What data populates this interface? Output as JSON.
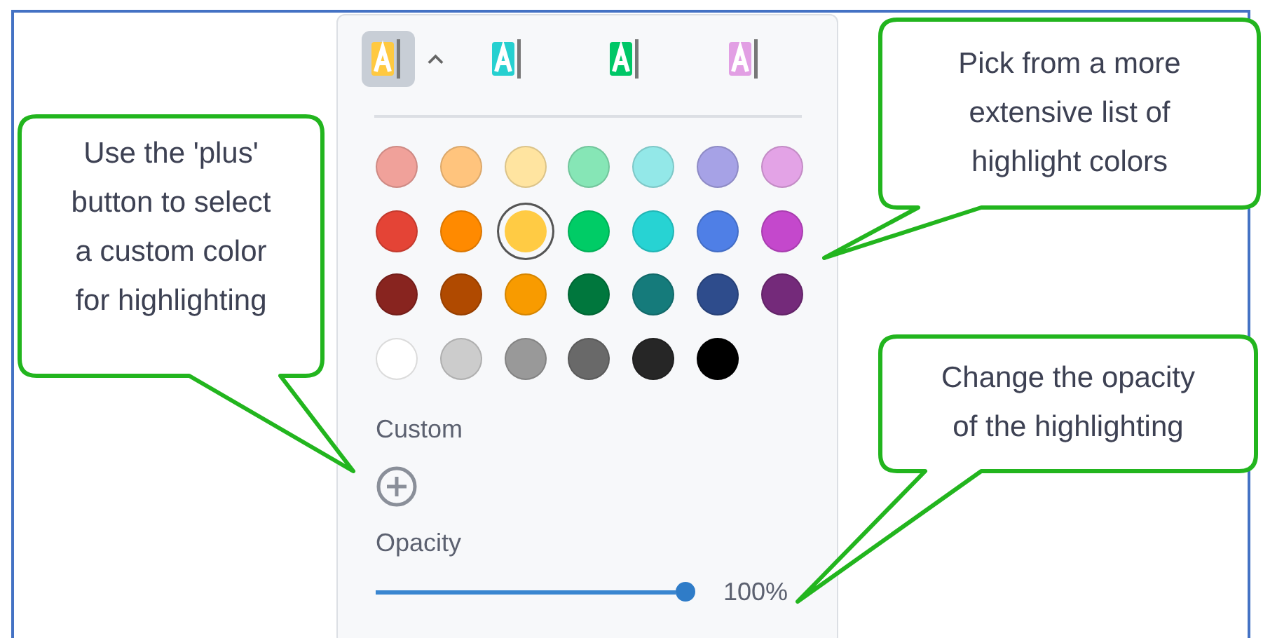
{
  "toolbar": {
    "tools": [
      {
        "color": "#ffc940",
        "selected": true
      },
      {
        "color": "#26d0d0",
        "selected": false
      },
      {
        "color": "#00c767",
        "selected": false
      },
      {
        "color": "#e29fe4",
        "selected": false
      }
    ]
  },
  "swatches": [
    {
      "color": "#f0a19a",
      "selected": false
    },
    {
      "color": "#ffc47d",
      "selected": false
    },
    {
      "color": "#ffe4a0",
      "selected": false
    },
    {
      "color": "#86e6b6",
      "selected": false
    },
    {
      "color": "#93e8e8",
      "selected": false
    },
    {
      "color": "#a6a2e6",
      "selected": false
    },
    {
      "color": "#e3a3e6",
      "selected": false
    },
    {
      "color": "#e44436",
      "selected": false
    },
    {
      "color": "#ff8a00",
      "selected": false
    },
    {
      "color": "#ffcb44",
      "selected": true
    },
    {
      "color": "#00cc66",
      "selected": false
    },
    {
      "color": "#27d3d3",
      "selected": false
    },
    {
      "color": "#4f7fe6",
      "selected": false
    },
    {
      "color": "#c448cc",
      "selected": false
    },
    {
      "color": "#88241f",
      "selected": false
    },
    {
      "color": "#b04a00",
      "selected": false
    },
    {
      "color": "#f89b00",
      "selected": false
    },
    {
      "color": "#00773d",
      "selected": false
    },
    {
      "color": "#157b7b",
      "selected": false
    },
    {
      "color": "#2e4c8c",
      "selected": false
    },
    {
      "color": "#742a7a",
      "selected": false
    },
    {
      "color": "#ffffff",
      "selected": false
    },
    {
      "color": "#cccccc",
      "selected": false
    },
    {
      "color": "#999999",
      "selected": false
    },
    {
      "color": "#696969",
      "selected": false
    },
    {
      "color": "#262626",
      "selected": false
    },
    {
      "color": "#000000",
      "selected": false
    }
  ],
  "custom": {
    "label": "Custom"
  },
  "opacity": {
    "label": "Opacity",
    "level": 1,
    "reading": "100%"
  },
  "callouts": [
    {
      "text": "Use the 'plus'\nbutton to select\na custom color\nfor highlighting"
    },
    {
      "text": "Pick from a more\nextensive list of\nhighlight colors"
    },
    {
      "text": "Change the opacity\nof the highlighting"
    }
  ]
}
